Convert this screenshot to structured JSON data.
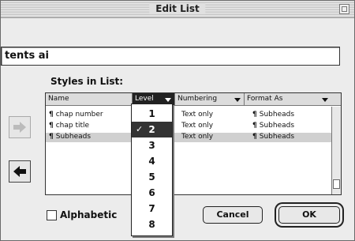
{
  "window": {
    "title": "Edit List"
  },
  "name_field": {
    "value": "tents ai"
  },
  "styles_label": "Styles in List:",
  "columns": {
    "name": "Name",
    "level": "Level",
    "numbering": "Numbering",
    "format_as": "Format As"
  },
  "rows": [
    {
      "name": "chap number",
      "numbering": "Text only",
      "format": "Subheads"
    },
    {
      "name": "chap title",
      "numbering": "Text only",
      "format": "Subheads"
    },
    {
      "name": "Subheads",
      "numbering": "Text only",
      "format": "Subheads"
    }
  ],
  "pilcrow": "¶",
  "level_menu": {
    "items": [
      "1",
      "2",
      "3",
      "4",
      "5",
      "6",
      "7",
      "8"
    ],
    "selected": "2",
    "check": "✓"
  },
  "alphabetical_label": "Alphabetic",
  "buttons": {
    "cancel": "Cancel",
    "ok": "OK"
  },
  "icons": {
    "add": "right-arrow-icon",
    "remove": "left-arrow-icon"
  }
}
